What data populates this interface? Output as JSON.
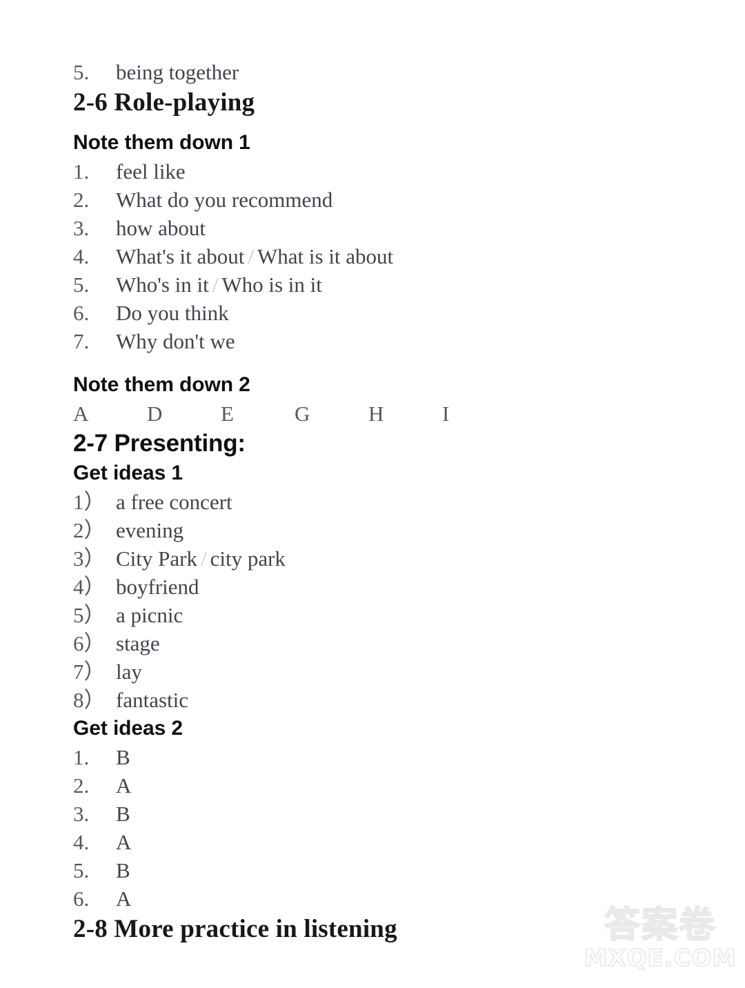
{
  "document": {
    "intro_item": {
      "num": "5.",
      "text": "being together"
    },
    "sections": [
      {
        "id": "section-2-6",
        "heading": "2-6 Role-playing",
        "heading_style": "serif",
        "subsections": [
          {
            "id": "note-them-down-1",
            "title": "Note them down 1",
            "list_type": "numbered-dot",
            "items": [
              {
                "num": "1.",
                "text": "feel like"
              },
              {
                "num": "2.",
                "text": "What do you recommend"
              },
              {
                "num": "3.",
                "text": "how about"
              },
              {
                "num": "4.",
                "text": "What's it about",
                "sep": "/",
                "alt": "What is it about"
              },
              {
                "num": "5.",
                "text": "Who's in it",
                "sep": "/",
                "alt": "Who is in it"
              },
              {
                "num": "6.",
                "text": "Do you think"
              },
              {
                "num": "7.",
                "text": "Why don't we"
              }
            ]
          },
          {
            "id": "note-them-down-2",
            "title": "Note them down 2",
            "list_type": "letters",
            "letters": [
              "A",
              "D",
              "E",
              "G",
              "H",
              "I"
            ]
          }
        ]
      },
      {
        "id": "section-2-7",
        "heading": "2-7 Presenting:",
        "heading_style": "sans",
        "subsections": [
          {
            "id": "get-ideas-1",
            "title": "Get ideas 1",
            "list_type": "numbered-paren",
            "items": [
              {
                "num": "1）",
                "text": "a free concert"
              },
              {
                "num": "2）",
                "text": "evening"
              },
              {
                "num": "3）",
                "text": "City Park",
                "sep": "/",
                "alt": "city park"
              },
              {
                "num": "4）",
                "text": "boyfriend"
              },
              {
                "num": "5）",
                "text": "a picnic"
              },
              {
                "num": "6）",
                "text": "stage"
              },
              {
                "num": "7）",
                "text": "lay"
              },
              {
                "num": "8）",
                "text": "fantastic"
              }
            ]
          },
          {
            "id": "get-ideas-2",
            "title": "Get ideas 2",
            "list_type": "numbered-dot",
            "items": [
              {
                "num": "1.",
                "text": "B"
              },
              {
                "num": "2.",
                "text": "A"
              },
              {
                "num": "3.",
                "text": "B"
              },
              {
                "num": "4.",
                "text": "A"
              },
              {
                "num": "5.",
                "text": "B"
              },
              {
                "num": "6.",
                "text": "A"
              }
            ]
          }
        ]
      },
      {
        "id": "section-2-8",
        "heading": "2-8 More practice in listening",
        "heading_style": "serif",
        "subsections": []
      }
    ]
  },
  "watermark": {
    "logo_text": "答案卷",
    "domain": "MXQE.COM",
    "color": "#e9e9e9"
  },
  "colors": {
    "page_background": "#ffffff",
    "heading_text": "#101014",
    "body_text": "#43434e",
    "watermark": "#e9e9e9"
  }
}
